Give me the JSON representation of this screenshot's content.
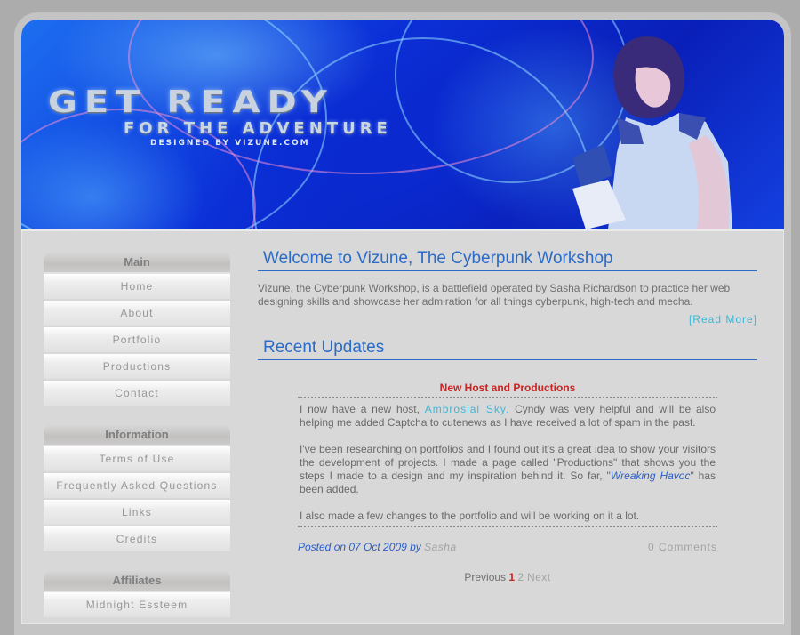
{
  "banner": {
    "title": "GET READY",
    "subtitle": "FOR THE ADVENTURE",
    "credit": "DESIGNED BY VIZUNE.COM"
  },
  "sidebar": {
    "blocks": [
      {
        "heading": "Main",
        "items": [
          {
            "label": "Home"
          },
          {
            "label": "About"
          },
          {
            "label": "Portfolio"
          },
          {
            "label": "Productions"
          },
          {
            "label": "Contact"
          }
        ]
      },
      {
        "heading": "Information",
        "items": [
          {
            "label": "Terms of Use"
          },
          {
            "label": "Frequently Asked Questions"
          },
          {
            "label": "Links"
          },
          {
            "label": "Credits"
          }
        ]
      },
      {
        "heading": "Affiliates",
        "items": [
          {
            "label": "Midnight Essteem"
          }
        ]
      }
    ]
  },
  "main": {
    "welcome_heading": "Welcome to Vizune, The Cyberpunk Workshop",
    "intro_text": "Vizune, the Cyberpunk Workshop, is a battlefield operated by Sasha Richardson to practice her web designing skills and showcase her admiration for all things cyberpunk, high-tech and mecha.",
    "read_more": "[Read More]",
    "updates_heading": "Recent Updates",
    "news": {
      "title": "New Host and Productions",
      "p1_before": "I now have a new host, ",
      "p1_link": "Ambrosial Sky.",
      "p1_after": " Cyndy was very helpful and will be also helping me added Captcha to cutenews as I have received a lot of spam in the past.",
      "p2_before": "I've been researching on portfolios and I found out it's a great idea to show your visitors the development of projects. I made a page called \"Productions\" that shows you the steps I made to a design and my inspiration behind it. So far, \"",
      "p2_link": "Wreaking Havoc",
      "p2_after": "\" has been added.",
      "p3": "I also made a few changes to the portfolio and will be working on it a lot.",
      "posted_prefix": "Posted on 07 Oct 2009 by ",
      "author": "Sasha",
      "comments": "0 Comments"
    },
    "pager": {
      "previous": "Previous",
      "current": "1",
      "page2": "2",
      "next": "Next"
    }
  }
}
